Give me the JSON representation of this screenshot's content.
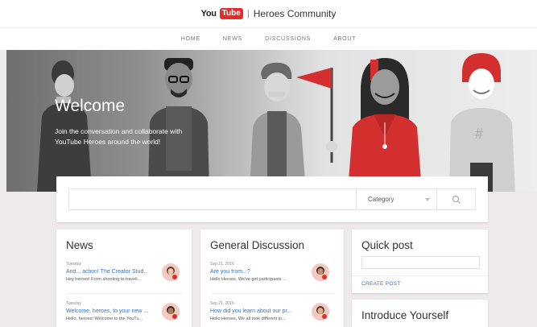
{
  "header": {
    "logo_you": "You",
    "logo_tube": "Tube",
    "logo_separator": "|",
    "community_title": "Heroes Community"
  },
  "nav": {
    "items": [
      "HOME",
      "NEWS",
      "DISCUSSIONS",
      "ABOUT"
    ]
  },
  "hero": {
    "title": "Welcome",
    "subtitle": "Join the conversation and collaborate with YouTube Heroes around the world!"
  },
  "search": {
    "placeholder": "",
    "category_label": "Category"
  },
  "news": {
    "title": "News",
    "posts": [
      {
        "date": "Tuesday",
        "title": "And... action! The Creator Stud..",
        "snippet": "Hey heroes! From shooting to traveli..."
      },
      {
        "date": "Tuesday",
        "title": "Welcome, heroes, to your new ...",
        "snippet": "Hello, heroes! Welcome to the YouTu..."
      }
    ]
  },
  "general": {
    "title": "General Discussion",
    "posts": [
      {
        "date": "Sep 21, 2016",
        "title": "Are you from...?",
        "snippet": "Hello Heroes, We've got participants ..."
      },
      {
        "date": "Sep 21, 2016",
        "title": "How did you learn about our pr...",
        "snippet": "Hello Heroes, We all took different jo..."
      }
    ]
  },
  "quick_post": {
    "title": "Quick post",
    "input_placeholder": "",
    "create_label": "CREATE POST"
  },
  "introduce": {
    "title": "Introduce Yourself"
  },
  "colors": {
    "accent_red": "#e52d27",
    "link_blue": "#2f74d1",
    "page_bg": "#eeeae9"
  }
}
